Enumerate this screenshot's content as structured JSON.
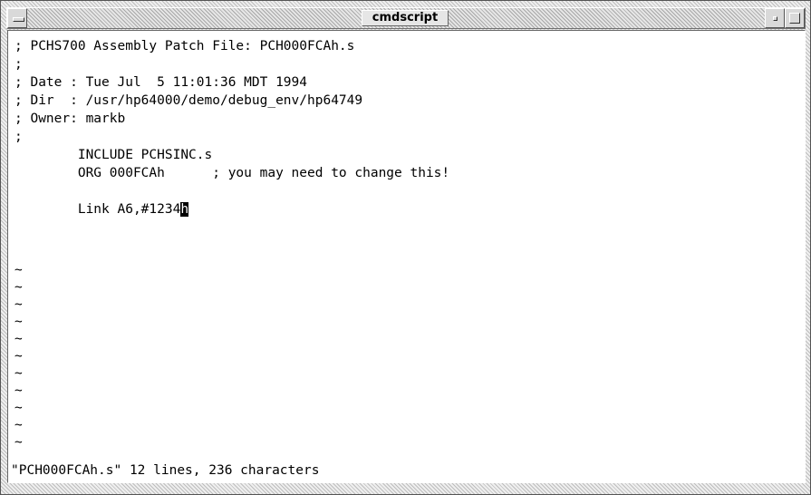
{
  "window": {
    "title": "cmdscript"
  },
  "content": {
    "lines": [
      "; PCHS700 Assembly Patch File: PCH000FCAh.s",
      ";",
      "; Date : Tue Jul  5 11:01:36 MDT 1994",
      "; Dir  : /usr/hp64000/demo/debug_env/hp64749",
      "; Owner: markb",
      ";",
      "        INCLUDE PCHSINC.s",
      "        ORG 000FCAh      ; you may need to change this!",
      "",
      "        Link A6,#1234"
    ],
    "cursor_char": "h",
    "tilde_lines": [
      "~",
      "~",
      "~",
      "~",
      "~",
      "~",
      "~",
      "~",
      "~",
      "~",
      "~"
    ],
    "status_line": "\"PCH000FCAh.s\" 12 lines, 236 characters"
  },
  "icons": {
    "window_menu": "window-menu-icon",
    "minimize": "minimize-icon",
    "maximize": "maximize-icon"
  }
}
